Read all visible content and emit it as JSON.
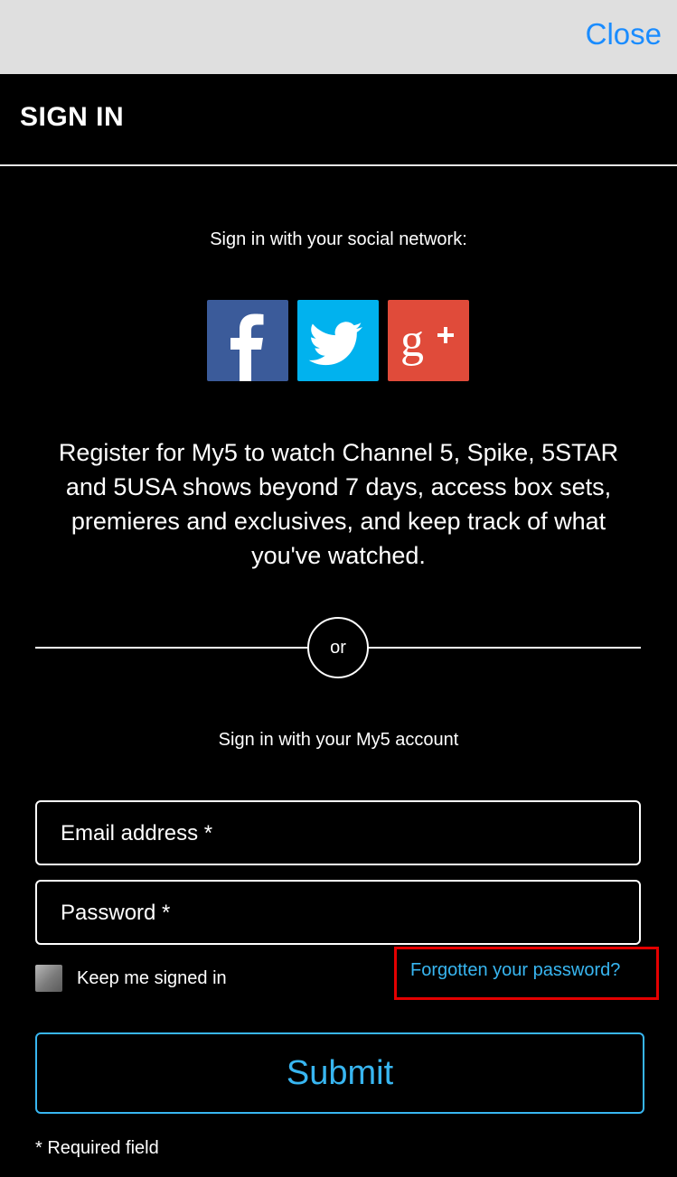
{
  "topbar": {
    "close_label": "Close"
  },
  "header": {
    "title": "SIGN IN"
  },
  "social": {
    "heading": "Sign in with your social network:",
    "networks": [
      {
        "name": "facebook-icon",
        "color": "#3b5b9a"
      },
      {
        "name": "twitter-icon",
        "color": "#01b2ee"
      },
      {
        "name": "google-plus-icon",
        "color": "#e04b3a"
      }
    ]
  },
  "register_text": "Register for My5 to watch Channel 5, Spike, 5STAR and 5USA shows beyond 7 days, access box sets, premieres and exclusives, and keep track of what you've watched.",
  "divider": {
    "label": "or"
  },
  "account": {
    "heading": "Sign in with your My5 account",
    "email_placeholder": "Email address *",
    "email_value": "",
    "password_placeholder": "Password *",
    "password_value": "",
    "keep_signed_in_label": "Keep me signed in",
    "keep_signed_in_checked": false,
    "forgot_label": "Forgotten your password?",
    "submit_label": "Submit",
    "required_note": "* Required field"
  },
  "colors": {
    "accent": "#38b6f1",
    "close": "#1a8cff",
    "highlight": "#e30000",
    "background": "#000000"
  }
}
